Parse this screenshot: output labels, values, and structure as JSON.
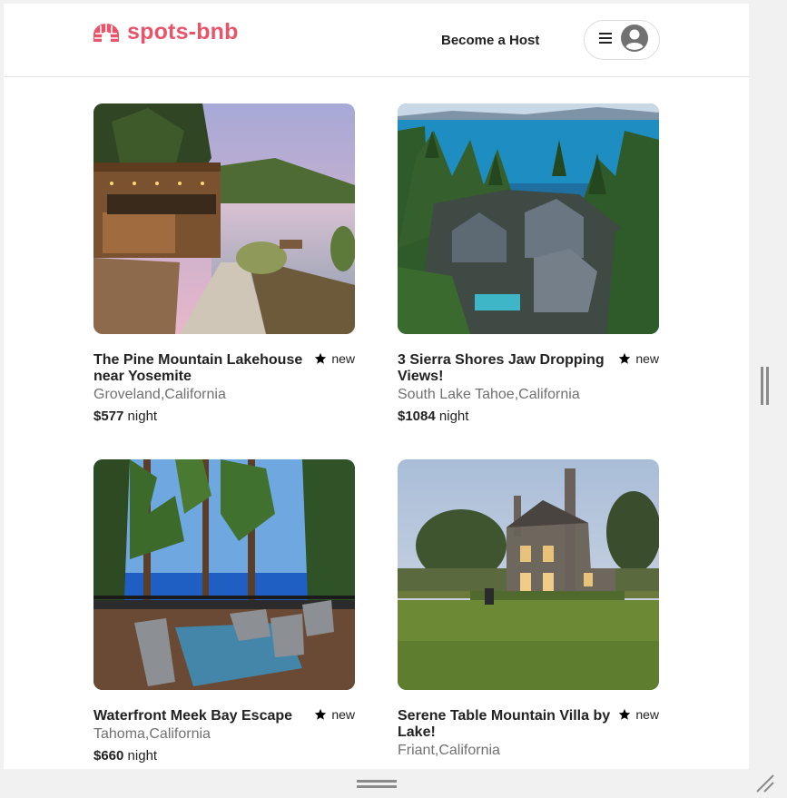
{
  "app": {
    "logo_text": "spots-bnb",
    "brand_color": "#e8546a",
    "logo_icon": "igloo-icon"
  },
  "header": {
    "host_label": "Become a Host",
    "menu_icon": "hamburger-icon",
    "profile_icon": "user-avatar-icon"
  },
  "listings": [
    {
      "title": "The Pine Mountain Lakehouse near Yosemite",
      "location": "Groveland,California",
      "price": "$577",
      "price_unit": "night",
      "rating": "new"
    },
    {
      "title": "3 Sierra Shores Jaw Dropping Views!",
      "location": "South Lake Tahoe,California",
      "price": "$1084",
      "price_unit": "night",
      "rating": "new"
    },
    {
      "title": "Waterfront Meek Bay Escape",
      "location": "Tahoma,California",
      "price": "$660",
      "price_unit": "night",
      "rating": "new"
    },
    {
      "title": "Serene Table Mountain Villa by Lake!",
      "location": "Friant,California",
      "price": "",
      "price_unit": "",
      "rating": "new"
    }
  ]
}
